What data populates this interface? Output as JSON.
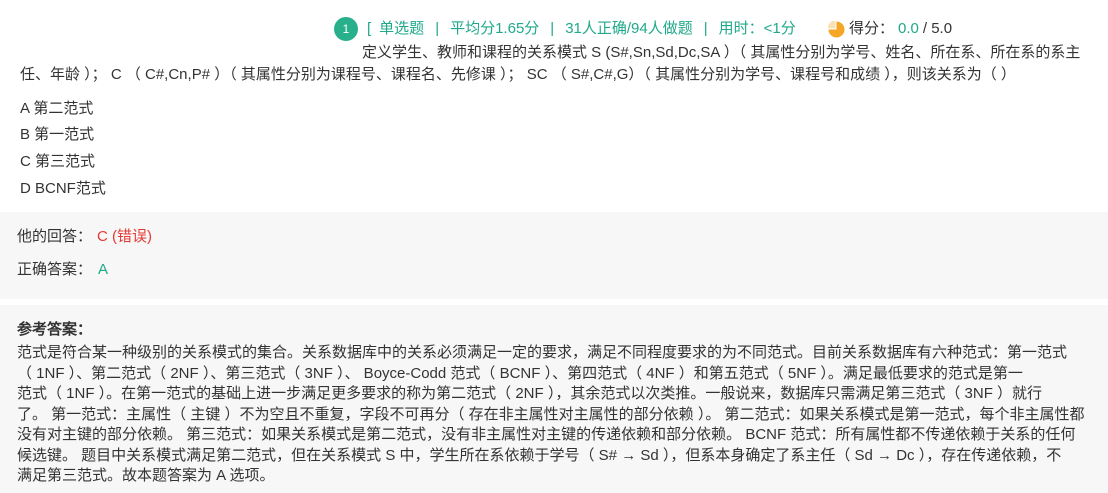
{
  "question": {
    "number": "1",
    "meta": {
      "open_bracket": "[",
      "separator": "|",
      "items": [
        "单选题",
        "平均分1.65分",
        "31人正确/94人做题",
        "用时：<1分"
      ]
    },
    "score": {
      "icon": "score-pie-icon",
      "label": "得分：",
      "value": "0.0",
      "total": "/ 5.0"
    },
    "text_lines": [
      "定义学生、教师和课程的关系模式 S (S#,Sn,Sd,Dc,SA ）（ 其属性分别为学号、姓名、所在系、所在系的系主",
      "任、年龄 ）； C （ C#,Cn,P# ）（ 其属性分别为课程号、课程名、先修课 ）； SC （ S#,C#,G）（ 其属性分别为学号、课程号和成绩 ），则该关系为（ ）"
    ],
    "options": [
      "A 第二范式",
      "B 第一范式",
      "C 第三范式",
      "D BCNF范式"
    ]
  },
  "answer": {
    "his_label": "他的回答：",
    "his_value": "C (错误)",
    "correct_label": "正确答案：",
    "correct_value": "A"
  },
  "reference": {
    "title": "参考答案：",
    "lines": [
      "范式是符合某一种级别的关系模式的集合。关系数据库中的关系必须满足一定的要求，满足不同程度要求的为不同范式。目前关系数据库有六种范式：第一范式",
      "（ 1NF ）、第二范式（ 2NF ）、第三范式（ 3NF ）、 Boyce-Codd 范式（ BCNF ）、第四范式（ 4NF ）和第五范式（ 5NF ）。满足最低要求的范式是第一",
      "范式（ 1NF ）。在第一范式的基础上进一步满足更多要求的称为第二范式（ 2NF ），其余范式以次类推。一般说来，数据库只需满足第三范式（ 3NF ）就行",
      "了。 第一范式：主属性（ 主键 ）不为空且不重复，字段不可再分（ 存在非主属性对主属性的部分依赖 ）。 第二范式：如果关系模式是第一范式，每个非主属性都",
      "没有对主键的部分依赖。 第三范式：如果关系模式是第二范式，没有非主属性对主键的传递依赖和部分依赖。 BCNF 范式：所有属性都不传递依赖于关系的任何",
      "候选键。 题目中关系模式满足第二范式，但在关系模式 S 中，学生所在系依赖于学号（ S# → Sd ），但系本身确定了系主任（ Sd → Dc ），存在传递依赖，不",
      "满足第三范式。故本题答案为 A 选项。"
    ]
  },
  "colors": {
    "accent": "#1fa98a",
    "badge": "#28b08c",
    "error": "#e53935",
    "score_icon": "#f5a623",
    "text": "#333333",
    "panel_bg": "#f7f7f7"
  }
}
